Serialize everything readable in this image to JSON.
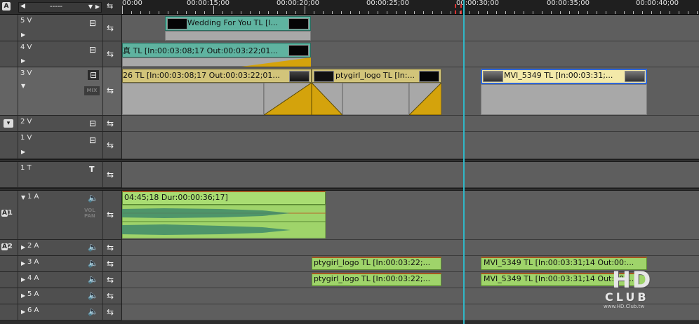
{
  "header": {
    "dropdown_value": "-----",
    "timecodes": [
      "00:00",
      "00:00:15;00",
      "00:00:20;00",
      "00:00:25;00",
      "00:00:30;00",
      "00:00:35;00",
      "00:00:40;00"
    ]
  },
  "tracks": {
    "v5": {
      "name": "5 V"
    },
    "v4": {
      "name": "4 V"
    },
    "v3": {
      "name": "3 V",
      "mix_label": "MIX"
    },
    "v2": {
      "name": "2 V"
    },
    "v1": {
      "name": "1 V"
    },
    "t1": {
      "name": "1 T"
    },
    "a1": {
      "name": "1 A",
      "side": "1",
      "vol_label": "VOL",
      "pan_label": "PAN"
    },
    "a2": {
      "name": "2 A",
      "side": "2"
    },
    "a3": {
      "name": "3 A"
    },
    "a4": {
      "name": "4 A"
    },
    "a5": {
      "name": "5 A"
    },
    "a6": {
      "name": "6 A"
    }
  },
  "clips": {
    "wedding": "Wedding For You  TL [I...",
    "v4_clip": "真  TL [In:00:03:08;17 Out:00:03:22;01...",
    "v3_clip1": "26  TL [In:00:03:08;17 Out:00:03:22;01...",
    "v3_ptygirl": "ptygirl_logo   TL [In:...",
    "v3_mvi": "MVI_5349   TL [In:00:03:31;...",
    "a1_clip": "04:45;18 Dur:00:00:36;17]",
    "a3_ptygirl": "ptygirl_logo   TL [In:00:03:22;...",
    "a3_mvi": "MVI_5349   TL [In:00:03:31;14 Out:00:...",
    "a4_ptygirl": "ptygirl_logo   TL [In:00:03:22;...",
    "a4_mvi": "MVI_5349   TL [In:00:03:31;14 Out:00:..."
  },
  "watermark": {
    "text1": "HD",
    "text2": "CLUB",
    "url": "www.HD.Club.tw"
  },
  "colors": {
    "title_clip": "#5fb3a0",
    "video_clip": "#d2c47a",
    "audio_clip": "#9fd46a",
    "transition": "#d4a30c",
    "playhead": "#2fb7c7",
    "selected_border": "#2f66d8"
  }
}
